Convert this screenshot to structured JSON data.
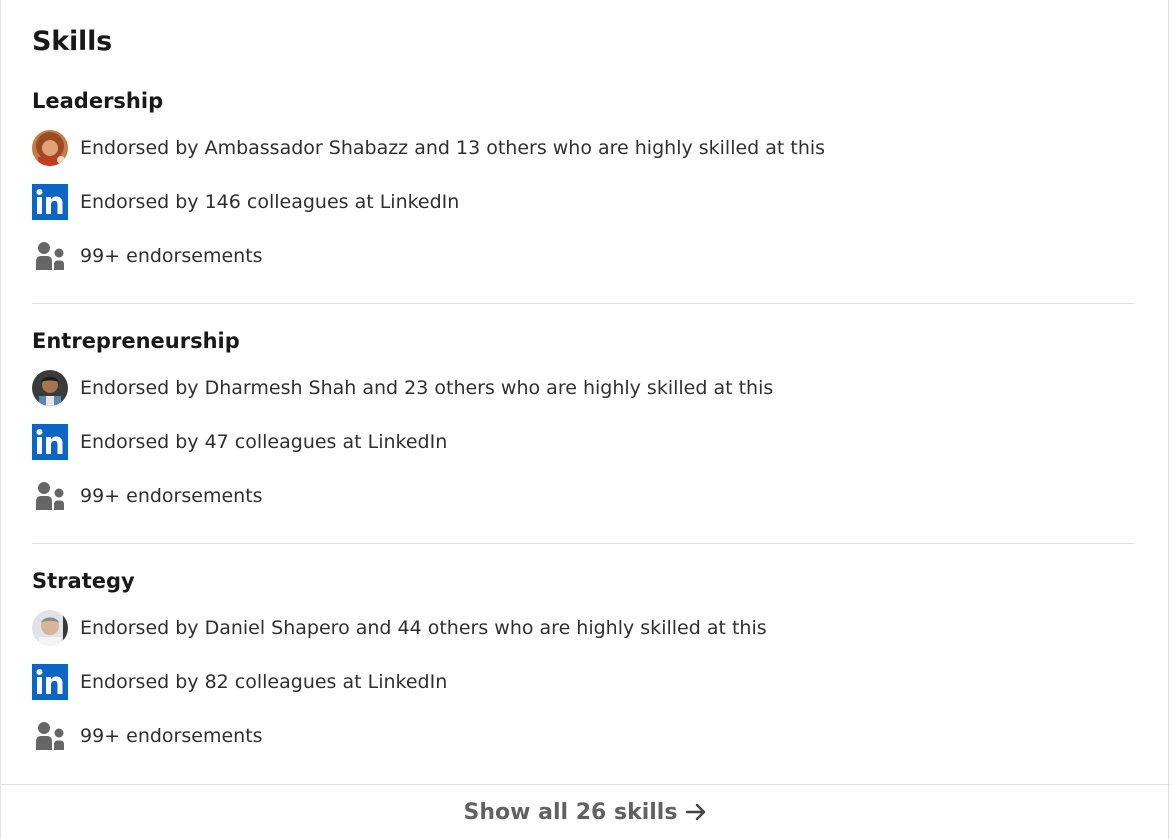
{
  "section": {
    "title": "Skills"
  },
  "skills": [
    {
      "name": "Leadership",
      "endorser_text": "Endorsed by Ambassador Shabazz and 13 others who are highly skilled at this",
      "colleagues_text": "Endorsed by 146 colleagues at LinkedIn",
      "count_text": "99+ endorsements"
    },
    {
      "name": "Entrepreneurship",
      "endorser_text": "Endorsed by Dharmesh Shah and 23 others who are highly skilled at this",
      "colleagues_text": "Endorsed by 47 colleagues at LinkedIn",
      "count_text": "99+ endorsements"
    },
    {
      "name": "Strategy",
      "endorser_text": "Endorsed by Daniel Shapero and 44 others who are highly skilled at this",
      "colleagues_text": "Endorsed by 82 colleagues at LinkedIn",
      "count_text": "99+ endorsements"
    }
  ],
  "footer": {
    "show_all_label": "Show all 26 skills"
  },
  "icons": {
    "linkedin": "linkedin-logo-icon",
    "people": "people-icon",
    "arrow": "arrow-right-icon",
    "avatar": "avatar"
  },
  "colors": {
    "linkedin_blue": "#0a66c2",
    "people_gray": "#666666",
    "divider": "#e0e0e0"
  }
}
